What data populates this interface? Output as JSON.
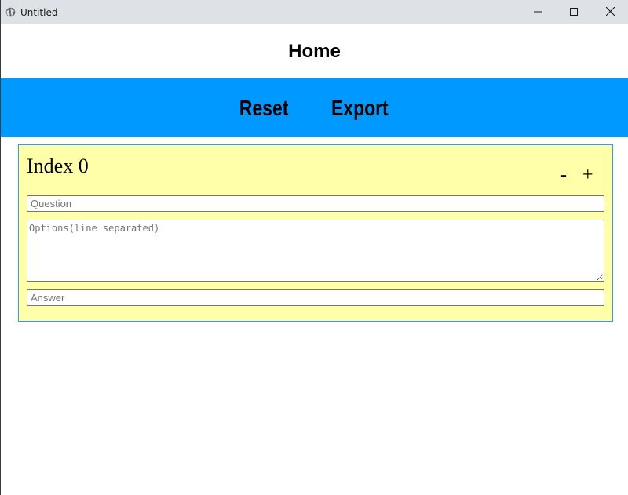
{
  "window": {
    "title": "Untitled",
    "icon": "globe-icon",
    "controls": [
      "minimize-icon",
      "maximize-icon",
      "close-icon"
    ]
  },
  "header": {
    "title": "Home"
  },
  "nav": {
    "reset_label": "Reset",
    "export_label": "Export",
    "background": "#0099ff"
  },
  "card": {
    "title": "Index 0",
    "minus_label": "-",
    "plus_label": "+",
    "background": "#ffffaa",
    "border": "#3399ff",
    "question": {
      "value": "",
      "placeholder": "Question"
    },
    "options": {
      "value": "",
      "placeholder": "Options(line separated)"
    },
    "answer": {
      "value": "",
      "placeholder": "Answer"
    }
  }
}
